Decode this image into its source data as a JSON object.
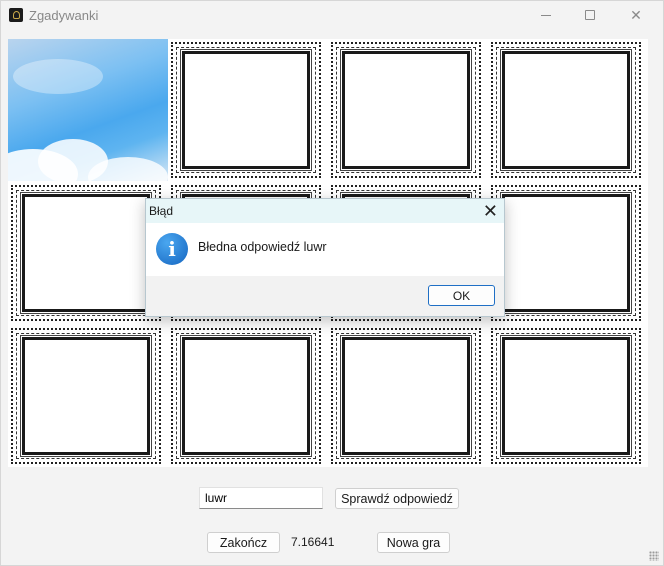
{
  "window": {
    "title": "Zgadywanki",
    "app_icon": "app-icon",
    "controls": [
      "minimize-icon",
      "maximize-icon",
      "close-icon"
    ]
  },
  "board": {
    "tiles": [
      {
        "state": "revealed",
        "image": "sky-clouds"
      },
      {
        "state": "hidden"
      },
      {
        "state": "hidden"
      },
      {
        "state": "hidden"
      },
      {
        "state": "hidden"
      },
      {
        "state": "hidden"
      },
      {
        "state": "hidden"
      },
      {
        "state": "hidden"
      },
      {
        "state": "hidden"
      },
      {
        "state": "hidden"
      },
      {
        "state": "hidden"
      },
      {
        "state": "hidden"
      }
    ]
  },
  "dialog": {
    "title": "Błąd",
    "message": "Błedna odpowiedź luwr",
    "icon": "info-icon",
    "ok_label": "OK"
  },
  "controls": {
    "answer_value": "luwr",
    "check_label": "Sprawdź odpowiedź",
    "end_label": "Zakończ",
    "timer": "7.16641",
    "new_game_label": "Nowa gra"
  },
  "colors": {
    "accent": "#1f6fc5",
    "dialog_title_bg": "#e7f6f8",
    "info_icon": "#1976d2"
  }
}
